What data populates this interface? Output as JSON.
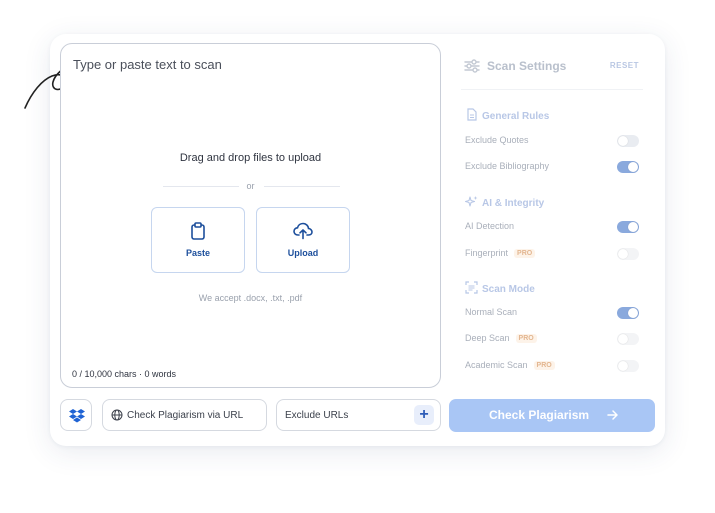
{
  "editor": {
    "placeholder": "Type or paste text to scan",
    "drop_title": "Drag and drop files to upload",
    "or_text": "or",
    "paste_label": "Paste",
    "upload_label": "Upload",
    "accept_text": "We accept .docx, .txt, .pdf",
    "counter": "0 / 10,000 chars · 0 words"
  },
  "settings": {
    "title": "Scan Settings",
    "reset_label": "RESET",
    "sections": [
      {
        "title": "General Rules",
        "icon": "document-icon",
        "rows": [
          {
            "label": "Exclude Quotes",
            "on": false
          },
          {
            "label": "Exclude Bibliography",
            "on": true
          }
        ]
      },
      {
        "title": "AI & Integrity",
        "icon": "sparkle-icon",
        "rows": [
          {
            "label": "AI Detection",
            "on": true
          },
          {
            "label": "Fingerprint",
            "pro": "PRO",
            "on": false
          }
        ]
      },
      {
        "title": "Scan Mode",
        "icon": "scan-icon",
        "rows": [
          {
            "label": "Normal Scan",
            "on": true
          },
          {
            "label": "Deep Scan",
            "pro": "PRO",
            "on": false
          },
          {
            "label": "Academic Scan",
            "pro": "PRO",
            "on": false
          }
        ]
      }
    ]
  },
  "bottom": {
    "url_label": "Check Plagiarism via URL",
    "exclude_label": "Exclude URLs",
    "check_label": "Check Plagiarism"
  },
  "colors": {
    "accent": "#1d4f9c",
    "toggle_on": "#8aa9dd",
    "check_button": "#a9c6f5",
    "pro_badge": "#e3b690"
  }
}
